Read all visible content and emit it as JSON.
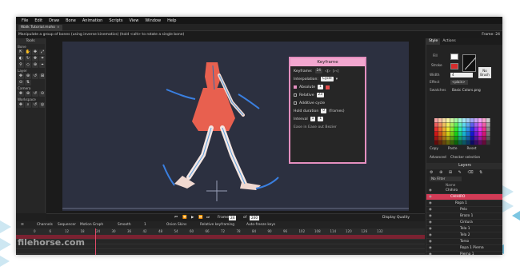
{
  "menu": [
    "File",
    "Edit",
    "Draw",
    "Bone",
    "Animation",
    "Scripts",
    "View",
    "Window",
    "Help"
  ],
  "document_tab": "Walk Tutorial.moho",
  "tab_close": "×",
  "status_text": "Manipulate a group of bones (using inverse kinematics) (hold <alt> to rotate a single bone)",
  "frame_label": "Frame: 24",
  "tools": {
    "title": "Tools",
    "bone_section": "Bone",
    "layer_section": "Layer",
    "camera_section": "Camera",
    "workspace_section": "Workspace",
    "bone_icons": [
      "⇱",
      "✋",
      "✚",
      "⤢",
      "◐",
      "↻",
      "✥",
      "⌗",
      "⚲",
      "◇",
      "⊕",
      "⌖"
    ],
    "layer_icons": [
      "✥",
      "⊕",
      "↺",
      "⊞",
      "⊙",
      "⇅"
    ],
    "camera_icons": [
      "✥",
      "⊕",
      "↺",
      "⊙"
    ],
    "workspace_icons": [
      "✥",
      "⌕",
      "↺",
      "◎"
    ]
  },
  "keyframe_dialog": {
    "title": "Keyframe",
    "keyframe_label": "Keyframe:",
    "keyframe_value": "24",
    "interpolation_label": "Interpolation:",
    "interpolation_value": "Cycle",
    "absolute_label": "Absolute",
    "absolute_value": "1",
    "relative_label": "Relative",
    "relative_value": "23",
    "additive_label": "Additive cycle",
    "hold_label": "Hold duration",
    "hold_value": "0",
    "hold_unit": "(frames)",
    "interval_label": "Interval",
    "interval_value": "1",
    "interval_value2": "1",
    "bottom_labels": "Ease in   Ease out   Bezier"
  },
  "style_panel": {
    "tabs": [
      "Style",
      "Actions"
    ],
    "fill_label": "Fill",
    "stroke_label": "Stroke",
    "width_label": "Width",
    "width_value": "4",
    "effect_label": "Effect",
    "effect_value": "<plain>",
    "no_brush_label": "No Brush",
    "swatches_label": "Swatches",
    "swatches_value": "Basic Colors.png",
    "copy_label": "Copy",
    "paste_label": "Paste",
    "reset_label": "Reset",
    "advanced_label": "Advanced",
    "checker_label": "Checker selection"
  },
  "layers_panel": {
    "title": "Layers",
    "filter_label": "No Filter",
    "name_header": "Name",
    "tool_icons": "⚙ ⊕ ⊞ ✎ ⌫ ⇅",
    "items": [
      {
        "name": "Chihiro",
        "indent": 6
      },
      {
        "name": "CHIHIRO",
        "indent": 12
      },
      {
        "name": "Ropa 1",
        "indent": 18
      },
      {
        "name": "Pelo",
        "indent": 24
      },
      {
        "name": "Brazo 1",
        "indent": 24
      },
      {
        "name": "Cintura",
        "indent": 24
      },
      {
        "name": "Tela 1",
        "indent": 24
      },
      {
        "name": "Tela 2",
        "indent": 24
      },
      {
        "name": "Torso",
        "indent": 24
      },
      {
        "name": "Ropa 1 Pierna",
        "indent": 24
      },
      {
        "name": "Pierna 1",
        "indent": 24
      }
    ]
  },
  "playback": {
    "frame_label": "Frame",
    "frame_value": "24",
    "of_label": "of",
    "total_value": "240",
    "display_quality": "Display Quality"
  },
  "timeline": {
    "tabs": [
      "Channels",
      "Sequencer",
      "Motion Graph"
    ],
    "smooth_label": "Smooth",
    "smooth_value": "1",
    "onion_label": "Onion Skins",
    "relative_kf_label": "Relative keyframing",
    "autofreeze_label": "Auto-freeze keys",
    "ruler_marks": [
      "0",
      "6",
      "12",
      "18",
      "24",
      "30",
      "36",
      "42",
      "48",
      "54",
      "60",
      "66",
      "72",
      "78",
      "84",
      "90",
      "96",
      "102",
      "108",
      "114",
      "120",
      "126",
      "132"
    ]
  },
  "watermark": "filehorse.com",
  "colors": {
    "accent_pink": "#e58fc0",
    "selection_red": "#d23b56",
    "canvas_bg": "#2c3040",
    "dress_red": "#e8604f"
  }
}
